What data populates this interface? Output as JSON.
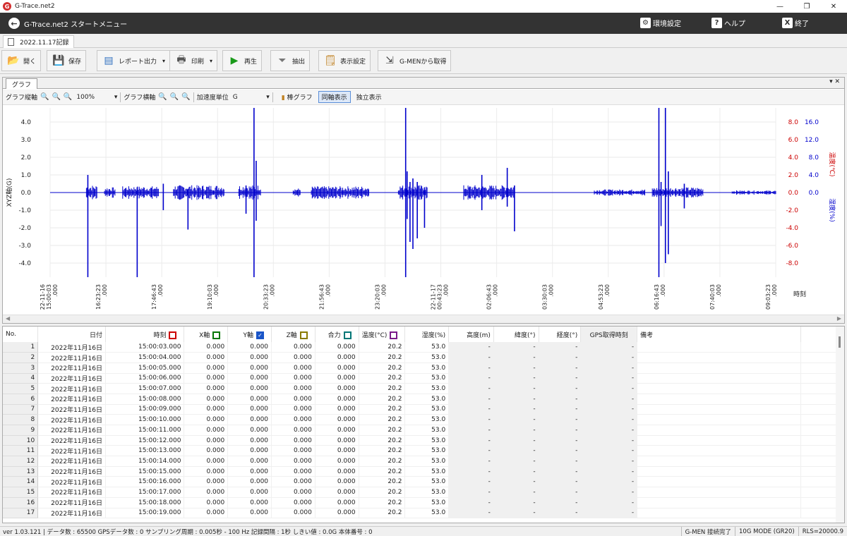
{
  "window": {
    "title": "G-Trace.net2",
    "logo_letter": "G",
    "minimize": "—",
    "maximize": "❐",
    "close": "✕"
  },
  "menubar": {
    "title": "G-Trace.net2 スタートメニュー",
    "settings_label": "環境設定",
    "help_label": "ヘルプ",
    "exit_label": "終了",
    "help_icon_glyph": "?",
    "exit_icon_glyph": "X"
  },
  "doc_tab": {
    "label": "2022.11.17記録"
  },
  "toolbar": {
    "open": "開く",
    "save": "保存",
    "report": "レポート出力",
    "print": "印刷",
    "play": "再生",
    "extract": "抽出",
    "display_settings": "表示設定",
    "get_from_gmen": "G-MENから取得",
    "dropdown": "▾"
  },
  "graph_panel": {
    "tab_label": "グラフ",
    "pin_label": "▾ ✕",
    "vertical_axis_label": "グラフ縦軸",
    "zoom_value": "100%",
    "horizontal_axis_label": "グラフ横軸",
    "accel_unit_label": "加速度単位",
    "accel_unit_value": "G",
    "bar_graph": "棒グラフ",
    "sync_display": "同軸表示",
    "independent_display": "独立表示",
    "dropdown": "▾",
    "zoom_icons": [
      "🔍",
      "🔍",
      "🔍"
    ],
    "scroll_left": "◀",
    "scroll_right": "▶"
  },
  "chart_data": {
    "type": "line",
    "series": [
      {
        "name": "Y軸",
        "color": "#0000cc"
      }
    ],
    "y_left": {
      "label": "XYZ軸(G)",
      "ticks": [
        "4.0",
        "3.0",
        "2.0",
        "1.0",
        "0.0",
        "-1.0",
        "-2.0",
        "-3.0",
        "-4.0"
      ],
      "range": [
        -4.8,
        4.8
      ]
    },
    "y_right_temp": {
      "label": "温度(℃)",
      "color": "#cc0000",
      "ticks": [
        "8.0",
        "6.0",
        "4.0",
        "2.0",
        "0.0",
        "-2.0",
        "-4.0",
        "-6.0",
        "-8.0"
      ]
    },
    "y_right_hum": {
      "label": "湿度(%)",
      "color": "#0000cc",
      "ticks": [
        "16.0",
        "12.0",
        "8.0",
        "4.0",
        "0.0"
      ]
    },
    "x_label": "時刻",
    "x_ticks": [
      {
        "date": "22-11-16",
        "time": "15:00:03",
        "ms": ".000"
      },
      {
        "date": "",
        "time": "16:23:23",
        "ms": ".000"
      },
      {
        "date": "",
        "time": "17:46:43",
        "ms": ".000"
      },
      {
        "date": "",
        "time": "19:10:03",
        "ms": ".000"
      },
      {
        "date": "",
        "time": "20:33:23",
        "ms": ".000"
      },
      {
        "date": "",
        "time": "21:56:43",
        "ms": ".000"
      },
      {
        "date": "",
        "time": "23:20:03",
        "ms": ".000"
      },
      {
        "date": "22-11-17",
        "time": "00:43:23",
        "ms": ".000"
      },
      {
        "date": "",
        "time": "02:06:43",
        "ms": ".000"
      },
      {
        "date": "",
        "time": "03:30:03",
        "ms": ".000"
      },
      {
        "date": "",
        "time": "04:53:23",
        "ms": ".000"
      },
      {
        "date": "",
        "time": "06:16:43",
        "ms": ".000"
      },
      {
        "date": "",
        "time": "07:40:03",
        "ms": ".000"
      },
      {
        "date": "",
        "time": "09:03:23",
        "ms": ".000"
      }
    ],
    "spikes": [
      {
        "t": 0.052,
        "hi": 1.0,
        "lo": -4.8
      },
      {
        "t": 0.12,
        "hi": 0.3,
        "lo": -4.8
      },
      {
        "t": 0.156,
        "hi": 0.5,
        "lo": -1.0
      },
      {
        "t": 0.19,
        "hi": 0.2,
        "lo": -2.1
      },
      {
        "t": 0.27,
        "hi": 0.4,
        "lo": -1.2
      },
      {
        "t": 0.281,
        "hi": 4.8,
        "lo": -4.8
      },
      {
        "t": 0.284,
        "hi": 1.8,
        "lo": -1.6
      },
      {
        "t": 0.49,
        "hi": 4.8,
        "lo": -4.8
      },
      {
        "t": 0.492,
        "hi": 1.2,
        "lo": -1.5
      },
      {
        "t": 0.496,
        "hi": 0.6,
        "lo": -2.8
      },
      {
        "t": 0.5,
        "hi": 0.8,
        "lo": -3.2
      },
      {
        "t": 0.506,
        "hi": 0.6,
        "lo": -2.6
      },
      {
        "t": 0.516,
        "hi": 0.3,
        "lo": -2.0
      },
      {
        "t": 0.595,
        "hi": 1.0,
        "lo": -1.0
      },
      {
        "t": 0.63,
        "hi": 1.4,
        "lo": -0.8
      },
      {
        "t": 0.64,
        "hi": 0.4,
        "lo": -2.2
      },
      {
        "t": 0.839,
        "hi": 4.8,
        "lo": -4.8
      },
      {
        "t": 0.842,
        "hi": 0.6,
        "lo": -1.9
      },
      {
        "t": 0.848,
        "hi": 4.8,
        "lo": -4.0
      },
      {
        "t": 0.852,
        "hi": 1.2,
        "lo": -3.5
      },
      {
        "t": 0.874,
        "hi": 0.5,
        "lo": -0.9
      }
    ],
    "noise_bands": [
      {
        "from": 0.05,
        "to": 0.065,
        "amp": 0.35
      },
      {
        "from": 0.075,
        "to": 0.09,
        "amp": 0.25
      },
      {
        "from": 0.1,
        "to": 0.15,
        "amp": 0.3
      },
      {
        "from": 0.17,
        "to": 0.24,
        "amp": 0.35
      },
      {
        "from": 0.26,
        "to": 0.29,
        "amp": 0.35
      },
      {
        "from": 0.335,
        "to": 0.345,
        "amp": 0.2
      },
      {
        "from": 0.36,
        "to": 0.44,
        "amp": 0.3
      },
      {
        "from": 0.48,
        "to": 0.52,
        "amp": 0.35
      },
      {
        "from": 0.57,
        "to": 0.64,
        "amp": 0.35
      },
      {
        "from": 0.75,
        "to": 0.82,
        "amp": 0.15
      },
      {
        "from": 0.83,
        "to": 0.9,
        "amp": 0.25
      },
      {
        "from": 0.94,
        "to": 1.0,
        "amp": 0.1
      }
    ]
  },
  "table": {
    "headers": [
      "No.",
      "日付",
      "時刻",
      "X軸",
      "Y軸",
      "Z軸",
      "合力",
      "温度(°C)",
      "湿度(%)",
      "高度(m)",
      "緯度(°)",
      "経度(°)",
      "GPS取得時刻",
      "備考"
    ],
    "checkbox_colors": {
      "time": "#cc0000",
      "x": "#007700",
      "y": "#1a55c8",
      "z": "#8a7a00",
      "resultant": "#007777",
      "temp": "#7a1a8a"
    },
    "y_checked_glyph": "✓",
    "rows": [
      [
        "1",
        "2022年11月16日",
        "15:00:03.000",
        "0.000",
        "0.000",
        "0.000",
        "0.000",
        "20.2",
        "53.0",
        "-",
        "-",
        "-",
        "-",
        ""
      ],
      [
        "2",
        "2022年11月16日",
        "15:00:04.000",
        "0.000",
        "0.000",
        "0.000",
        "0.000",
        "20.2",
        "53.0",
        "-",
        "-",
        "-",
        "-",
        ""
      ],
      [
        "3",
        "2022年11月16日",
        "15:00:05.000",
        "0.000",
        "0.000",
        "0.000",
        "0.000",
        "20.2",
        "53.0",
        "-",
        "-",
        "-",
        "-",
        ""
      ],
      [
        "4",
        "2022年11月16日",
        "15:00:06.000",
        "0.000",
        "0.000",
        "0.000",
        "0.000",
        "20.2",
        "53.0",
        "-",
        "-",
        "-",
        "-",
        ""
      ],
      [
        "5",
        "2022年11月16日",
        "15:00:07.000",
        "0.000",
        "0.000",
        "0.000",
        "0.000",
        "20.2",
        "53.0",
        "-",
        "-",
        "-",
        "-",
        ""
      ],
      [
        "6",
        "2022年11月16日",
        "15:00:08.000",
        "0.000",
        "0.000",
        "0.000",
        "0.000",
        "20.2",
        "53.0",
        "-",
        "-",
        "-",
        "-",
        ""
      ],
      [
        "7",
        "2022年11月16日",
        "15:00:09.000",
        "0.000",
        "0.000",
        "0.000",
        "0.000",
        "20.2",
        "53.0",
        "-",
        "-",
        "-",
        "-",
        ""
      ],
      [
        "8",
        "2022年11月16日",
        "15:00:10.000",
        "0.000",
        "0.000",
        "0.000",
        "0.000",
        "20.2",
        "53.0",
        "-",
        "-",
        "-",
        "-",
        ""
      ],
      [
        "9",
        "2022年11月16日",
        "15:00:11.000",
        "0.000",
        "0.000",
        "0.000",
        "0.000",
        "20.2",
        "53.0",
        "-",
        "-",
        "-",
        "-",
        ""
      ],
      [
        "10",
        "2022年11月16日",
        "15:00:12.000",
        "0.000",
        "0.000",
        "0.000",
        "0.000",
        "20.2",
        "53.0",
        "-",
        "-",
        "-",
        "-",
        ""
      ],
      [
        "11",
        "2022年11月16日",
        "15:00:13.000",
        "0.000",
        "0.000",
        "0.000",
        "0.000",
        "20.2",
        "53.0",
        "-",
        "-",
        "-",
        "-",
        ""
      ],
      [
        "12",
        "2022年11月16日",
        "15:00:14.000",
        "0.000",
        "0.000",
        "0.000",
        "0.000",
        "20.2",
        "53.0",
        "-",
        "-",
        "-",
        "-",
        ""
      ],
      [
        "13",
        "2022年11月16日",
        "15:00:15.000",
        "0.000",
        "0.000",
        "0.000",
        "0.000",
        "20.2",
        "53.0",
        "-",
        "-",
        "-",
        "-",
        ""
      ],
      [
        "14",
        "2022年11月16日",
        "15:00:16.000",
        "0.000",
        "0.000",
        "0.000",
        "0.000",
        "20.2",
        "53.0",
        "-",
        "-",
        "-",
        "-",
        ""
      ],
      [
        "15",
        "2022年11月16日",
        "15:00:17.000",
        "0.000",
        "0.000",
        "0.000",
        "0.000",
        "20.2",
        "53.0",
        "-",
        "-",
        "-",
        "-",
        ""
      ],
      [
        "16",
        "2022年11月16日",
        "15:00:18.000",
        "0.000",
        "0.000",
        "0.000",
        "0.000",
        "20.2",
        "53.0",
        "-",
        "-",
        "-",
        "-",
        ""
      ],
      [
        "17",
        "2022年11月16日",
        "15:00:19.000",
        "0.000",
        "0.000",
        "0.000",
        "0.000",
        "20.2",
        "53.0",
        "-",
        "-",
        "-",
        "-",
        ""
      ]
    ]
  },
  "status": {
    "left": "ver 1.03.121 | データ数 : 65500  GPSデータ数 : 0  サンプリング周期 : 0.005秒 - 100 Hz  記録間隔 : 1秒  しきい値 : 0.0G  本体番号 : 0",
    "connection": "G-MEN 接続完了",
    "mode": "10G MODE (GR20)",
    "rls": "RLS=20000.9"
  }
}
